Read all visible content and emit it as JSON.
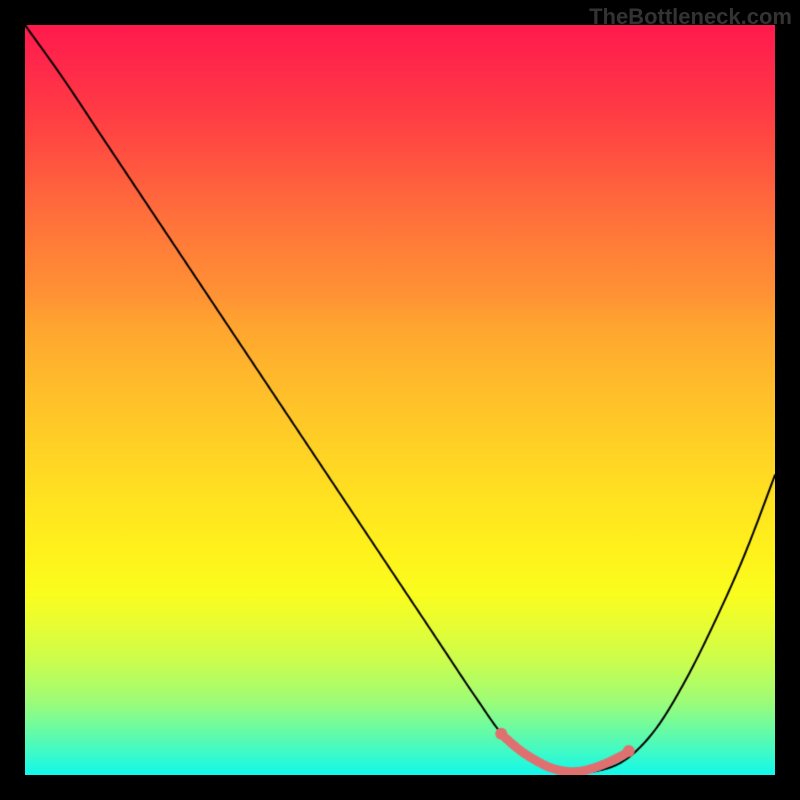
{
  "watermark": "TheBottleneck.com",
  "chart_data": {
    "type": "line",
    "title": "",
    "xlabel": "",
    "ylabel": "",
    "xlim": [
      0,
      1
    ],
    "ylim": [
      0,
      1
    ],
    "grid": false,
    "legend": false,
    "series": [
      {
        "name": "bottleneck-curve",
        "x": [
          0.0,
          0.05,
          0.1,
          0.15,
          0.2,
          0.25,
          0.3,
          0.35,
          0.4,
          0.45,
          0.5,
          0.55,
          0.6,
          0.64,
          0.68,
          0.72,
          0.76,
          0.8,
          0.84,
          0.88,
          0.92,
          0.96,
          1.0
        ],
        "y": [
          1.0,
          0.93,
          0.855,
          0.78,
          0.705,
          0.63,
          0.555,
          0.48,
          0.405,
          0.33,
          0.255,
          0.18,
          0.105,
          0.05,
          0.02,
          0.005,
          0.005,
          0.02,
          0.06,
          0.125,
          0.205,
          0.295,
          0.4
        ],
        "color": "#000000",
        "linewidth": 2
      },
      {
        "name": "optimal-zone",
        "x": [
          0.64,
          0.66,
          0.68,
          0.7,
          0.72,
          0.74,
          0.76,
          0.78,
          0.8
        ],
        "y": [
          0.05,
          0.033,
          0.02,
          0.01,
          0.005,
          0.005,
          0.01,
          0.018,
          0.028
        ],
        "color": "#e07070",
        "linewidth": 9
      }
    ],
    "optimal_zone_dots": {
      "color": "#e07070",
      "radius": 6,
      "points": [
        {
          "x": 0.635,
          "y": 0.055
        },
        {
          "x": 0.805,
          "y": 0.032
        }
      ]
    },
    "gradient": {
      "type": "vertical-linear",
      "stops": [
        {
          "pos": 0.0,
          "color": "#ff1a4d"
        },
        {
          "pos": 0.5,
          "color": "#ffcc26"
        },
        {
          "pos": 0.75,
          "color": "#fafd1e"
        },
        {
          "pos": 1.0,
          "color": "#12f8eb"
        }
      ]
    }
  }
}
